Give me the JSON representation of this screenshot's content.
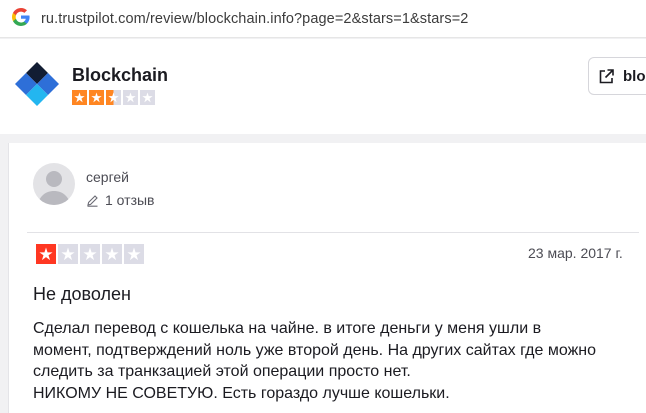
{
  "browser": {
    "url": "ru.trustpilot.com/review/blockchain.info?page=2&stars=1&stars=2",
    "search_icon": "google-g-icon"
  },
  "header": {
    "company_name": "Blockchain",
    "rating_fraction": 0.5,
    "website_button_label": "bloc",
    "website_icon": "external-link-icon"
  },
  "review": {
    "reviewer_name": "сергей",
    "review_count": "1 отзыв",
    "stars": 1,
    "date": "23 мар. 2017 г.",
    "title": "Не доволен",
    "body_lines": [
      "Сделал перевод с кошелька на чайне. в итоге деньги у меня ушли в",
      "момент, подтверждений ноль уже второй день. На других сайтах где можно",
      "следить за транкзацией этой операции просто нет.",
      "НИКОМУ НЕ СОВЕТУЮ. Есть гораздо лучше кошельки."
    ]
  },
  "colors": {
    "star_one": "#ff3722",
    "star_two": "#ff8622",
    "star_empty": "#dcdce6",
    "logo_dark": "#121d33",
    "logo_blue": "#2e6fd8",
    "logo_cyan": "#23b6f0"
  }
}
